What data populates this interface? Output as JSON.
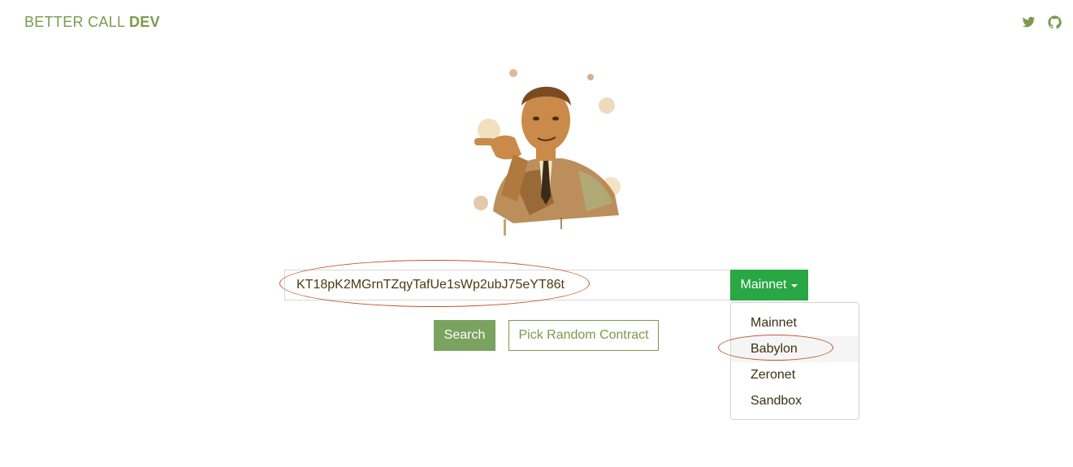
{
  "header": {
    "brand_light": "BETTER CALL ",
    "brand_bold": "DEV",
    "icons": [
      "twitter-icon",
      "github-icon"
    ]
  },
  "search": {
    "value": "KT18pK2MGrnTZqyTafUe1sWp2ubJ75eYT86t",
    "search_label": "Search",
    "random_label": "Pick Random Contract"
  },
  "network": {
    "selected": "Mainnet",
    "options": [
      "Mainnet",
      "Babylon",
      "Zeronet",
      "Sandbox"
    ]
  },
  "colors": {
    "brand": "#7c9a4a",
    "selector": "#28a745",
    "search_button": "#79a35e",
    "annotation": "#c0552b"
  }
}
